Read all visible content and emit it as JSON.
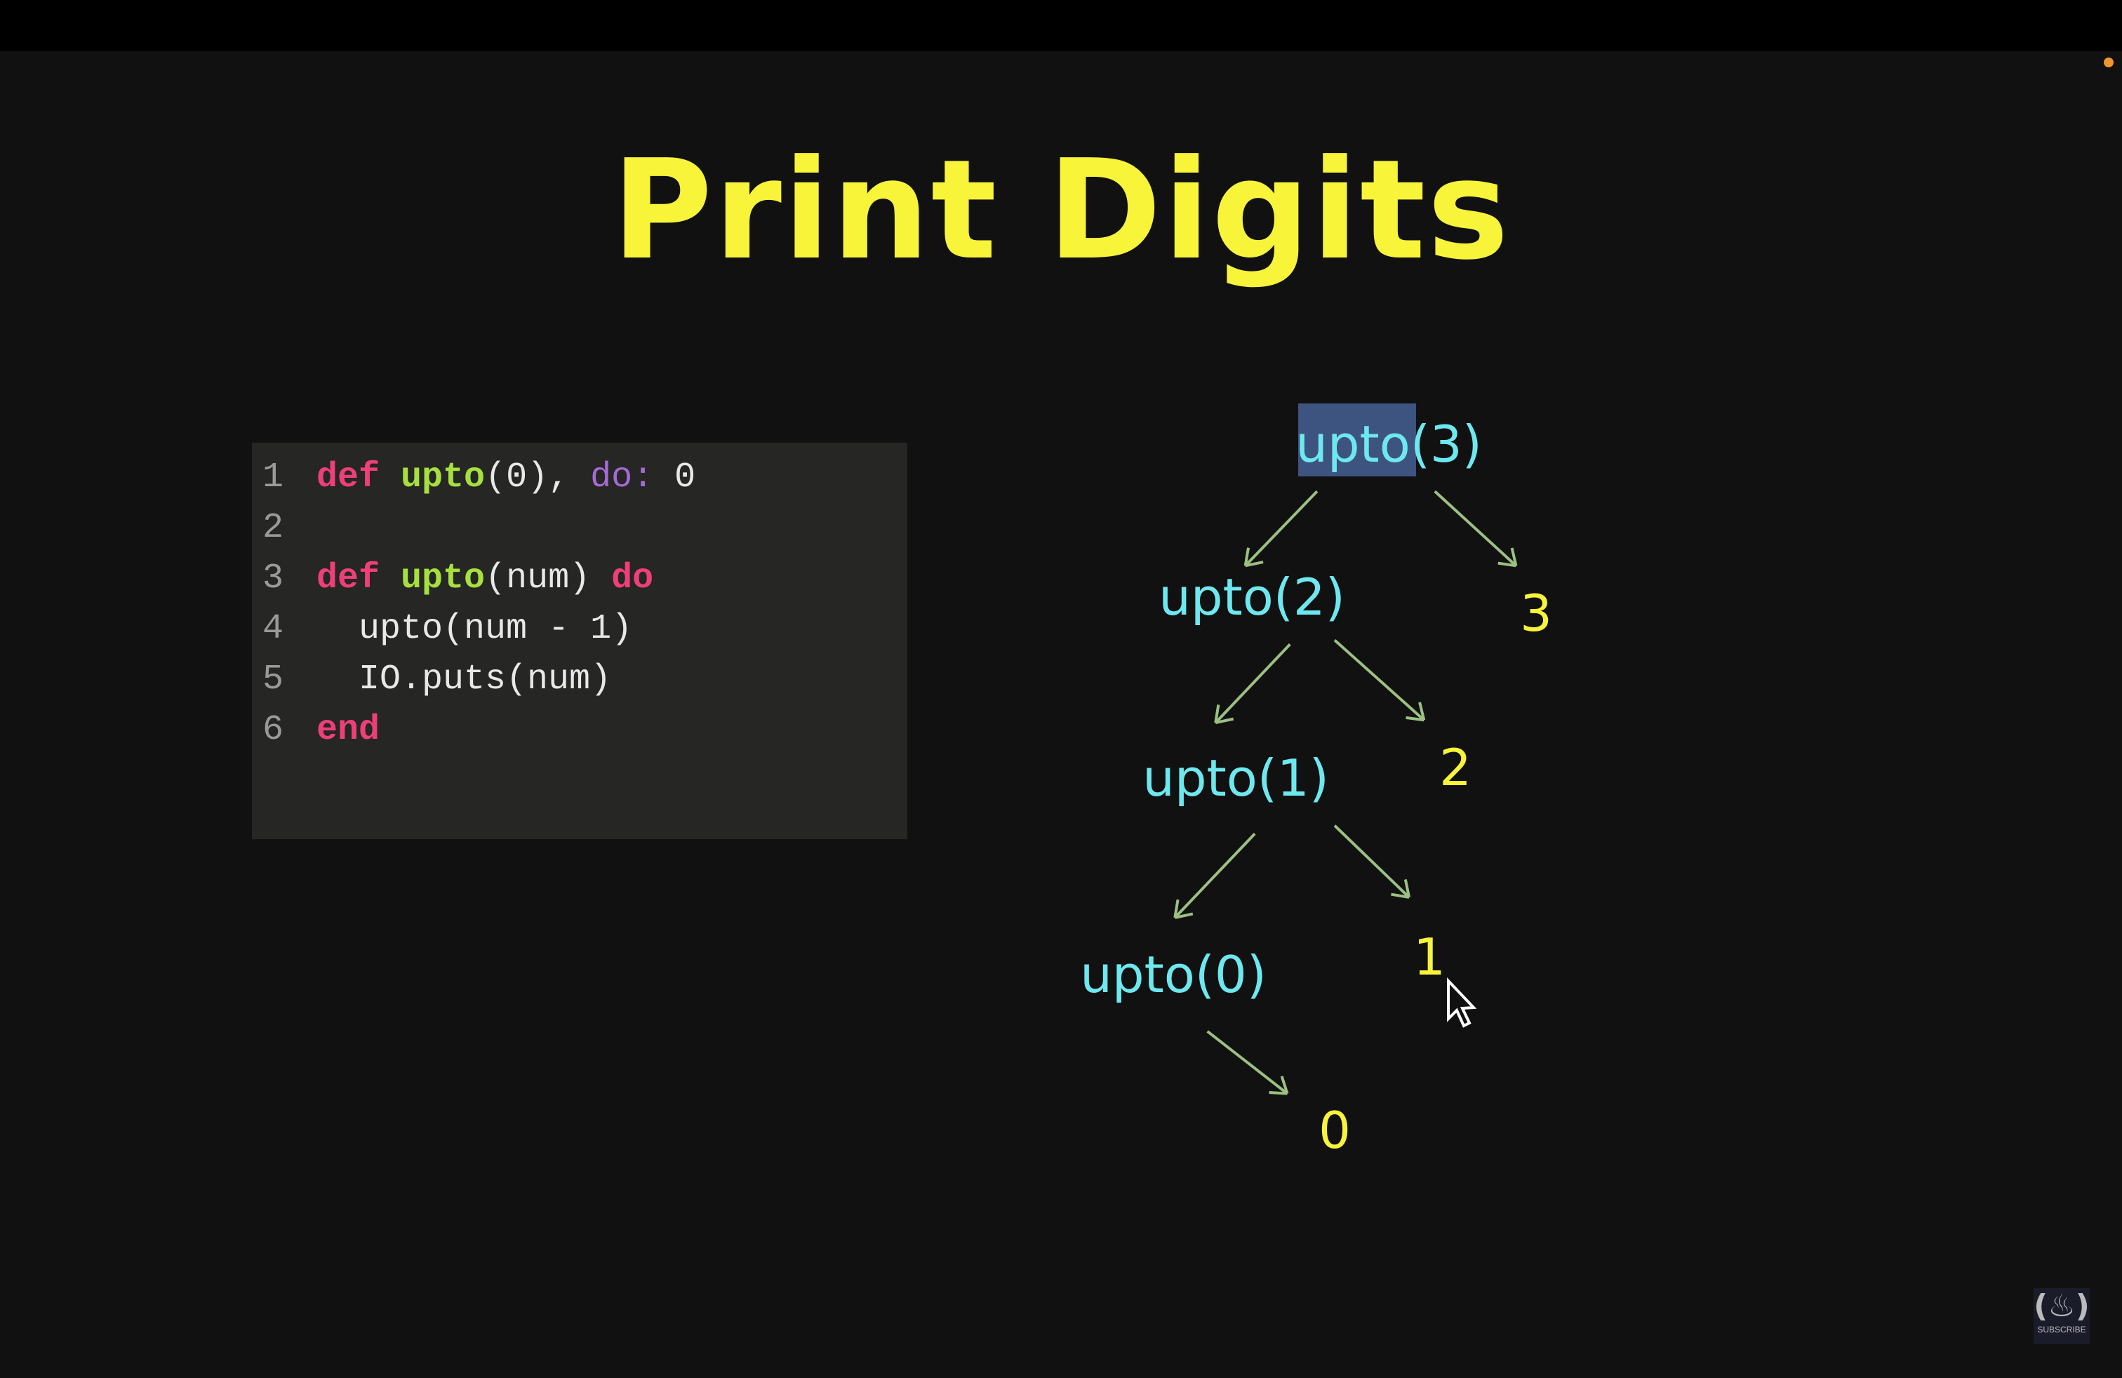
{
  "title": "Print Digits",
  "code": {
    "line_numbers": [
      "1",
      "2",
      "3",
      "4",
      "5",
      "6"
    ],
    "lines": [
      [
        {
          "t": "def",
          "c": "kw"
        },
        {
          "t": " "
        },
        {
          "t": "upto",
          "c": "fn"
        },
        {
          "t": "(0), "
        },
        {
          "t": "do:",
          "c": "at"
        },
        {
          "t": " 0"
        }
      ],
      [],
      [
        {
          "t": "def",
          "c": "kw"
        },
        {
          "t": " "
        },
        {
          "t": "upto",
          "c": "fn"
        },
        {
          "t": "(num) "
        },
        {
          "t": "do",
          "c": "kw"
        }
      ],
      [
        {
          "t": "  upto(num - 1)"
        }
      ],
      [
        {
          "t": "  IO.puts(num)"
        }
      ],
      [
        {
          "t": "end",
          "c": "kw"
        }
      ]
    ]
  },
  "tree": {
    "highlighted_text": "upto",
    "nodes": {
      "upto3": "upto(3)",
      "upto2": "upto(2)",
      "out3": "3",
      "upto1": "upto(1)",
      "out2": "2",
      "upto0": "upto(0)",
      "out1": "1",
      "out0": "0"
    }
  },
  "logo": {
    "label": "SUBSCRIBE",
    "glyph": "(♨)"
  },
  "colors": {
    "accent": "#f7f43a",
    "call": "#6ee8ef",
    "arrow": "#9cc082",
    "keyword": "#ee3f7a",
    "function": "#a7e03e"
  }
}
